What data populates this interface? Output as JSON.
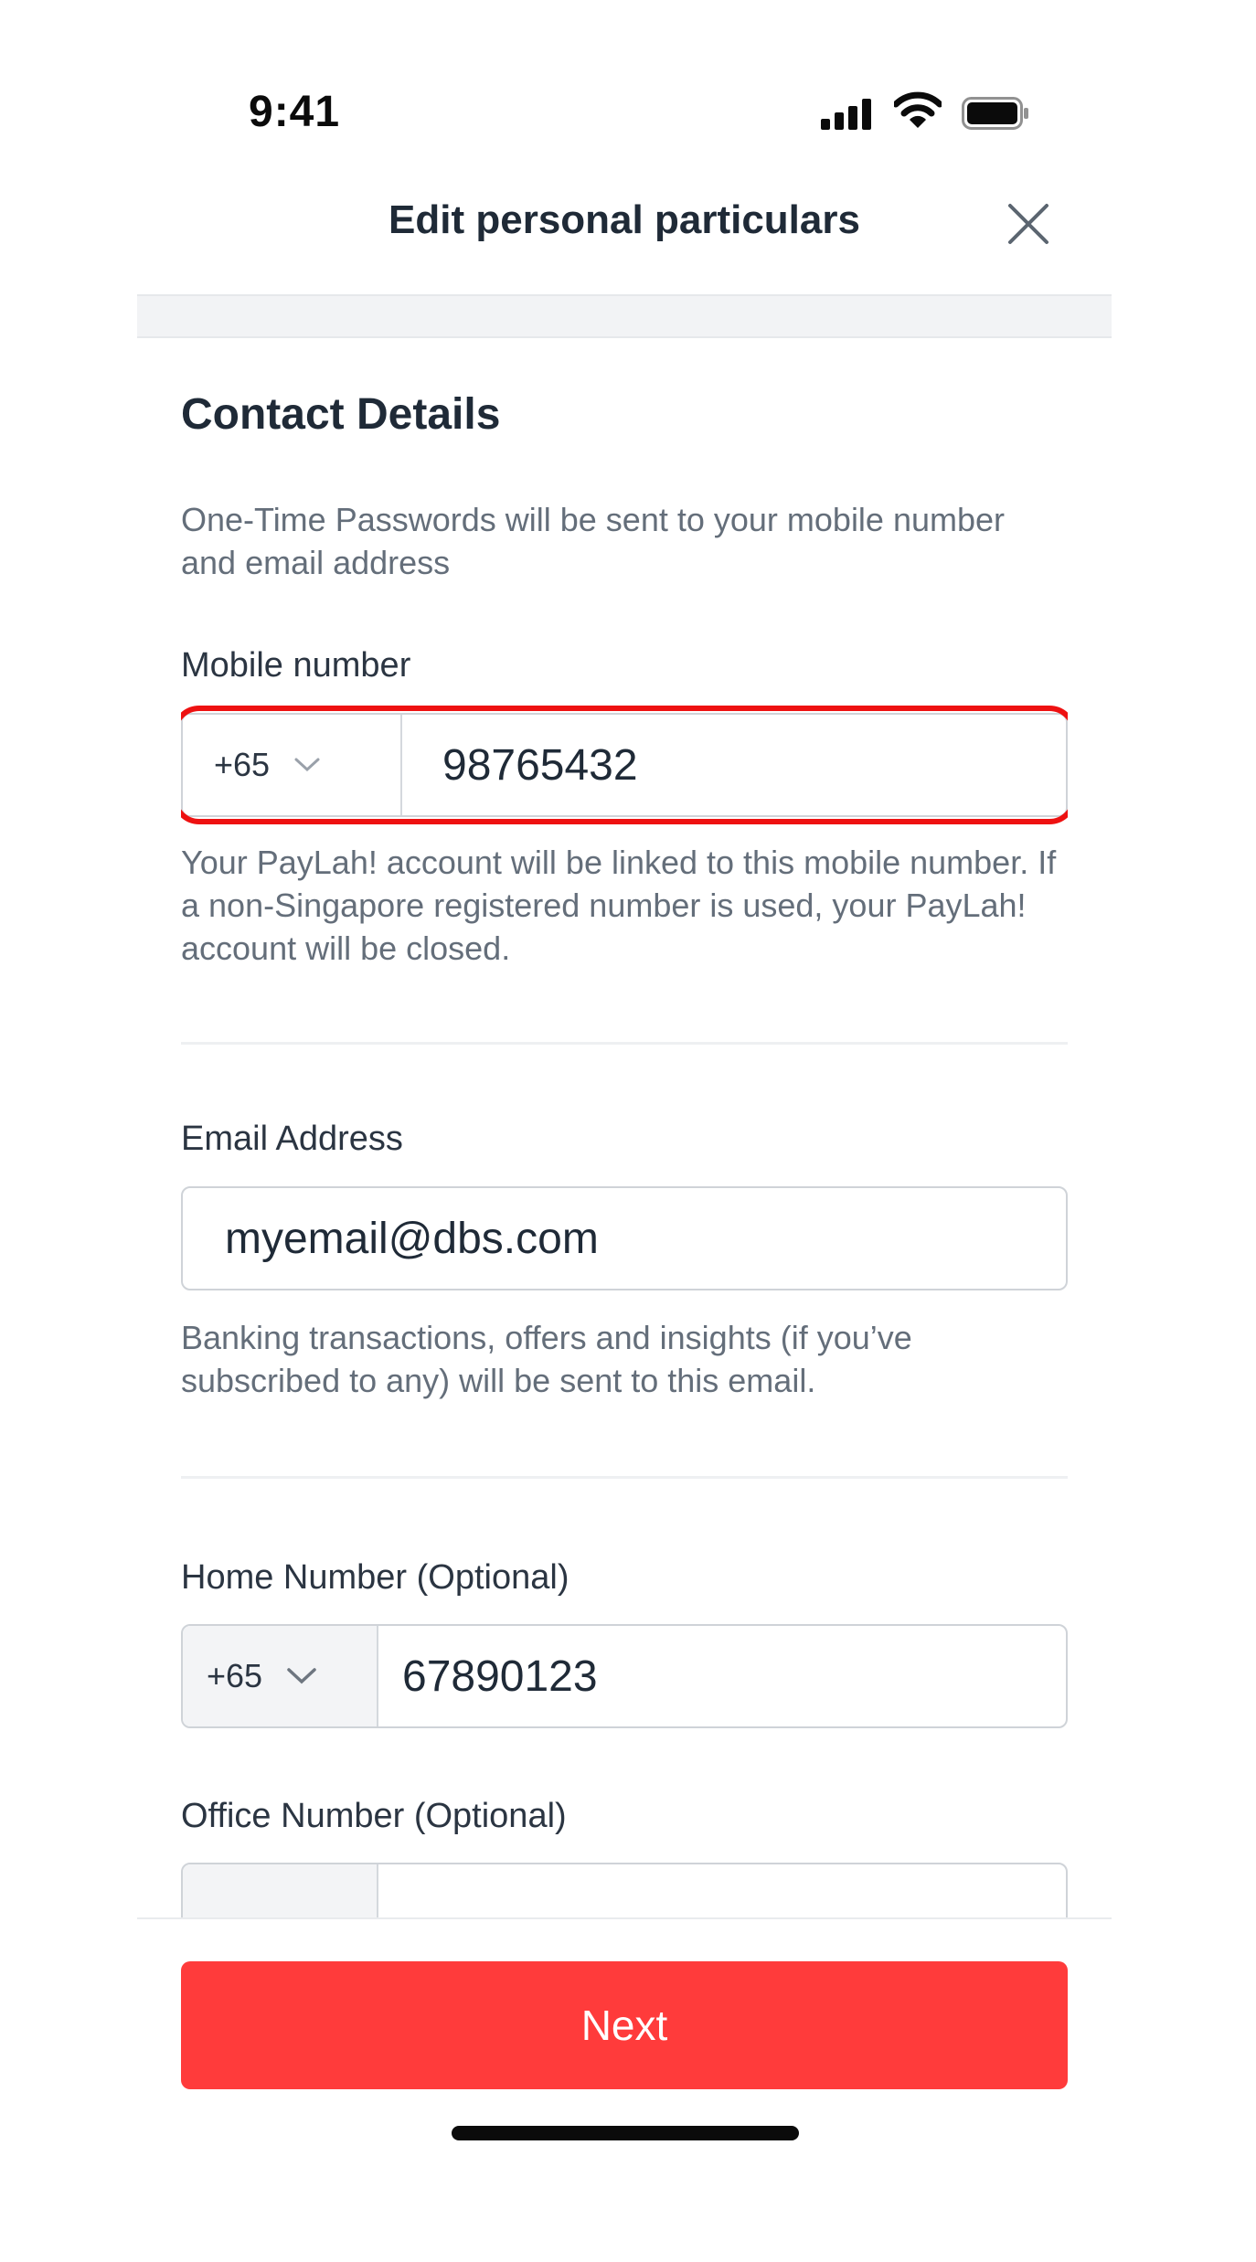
{
  "status_bar": {
    "time": "9:41"
  },
  "header": {
    "title": "Edit personal particulars"
  },
  "contact": {
    "title": "Contact Details",
    "description": "One-Time Passwords will be sent to your mobile number and email address"
  },
  "mobile": {
    "label": "Mobile number",
    "country_code": "+65",
    "value": "98765432",
    "helper": "Your PayLah! account will be linked to this mobile number. If a non-Singapore registered number is used, your PayLah! account will be closed."
  },
  "email": {
    "label": "Email Address",
    "value": "myemail@dbs.com",
    "helper": "Banking transactions, offers and insights (if you’ve subscribed to any) will be sent to this email."
  },
  "home": {
    "label": "Home Number (Optional)",
    "country_code": "+65",
    "value": "67890123"
  },
  "office": {
    "label": "Office Number (Optional)",
    "country_code": "",
    "value": ""
  },
  "footer": {
    "next_label": "Next"
  },
  "colors": {
    "accent": "#ff3b3b",
    "highlight": "#ee1111",
    "text_primary": "#1f2a37",
    "text_secondary": "#646e7a"
  },
  "icons": {
    "close": "close-icon",
    "chevron": "chevron-down-icon",
    "signal": "signal-icon",
    "wifi": "wifi-icon",
    "battery": "battery-icon"
  }
}
